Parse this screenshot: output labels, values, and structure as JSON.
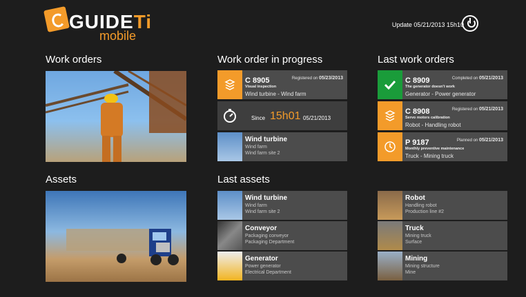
{
  "app": {
    "logo_guide": "GUIDE",
    "logo_ti": "Ti",
    "logo_mobile": "mobile",
    "update": "Update 05/21/2013 15h10"
  },
  "sections": {
    "work_orders": "Work orders",
    "in_progress": "Work order in progress",
    "last_work_orders": "Last work orders",
    "assets": "Assets",
    "last_assets": "Last assets"
  },
  "progress": {
    "code": "C 8905",
    "registered_label": "Registered on",
    "registered_date": "05/23/2013",
    "desc": "Visual inspection",
    "asset": "Wind turbine",
    "asset_sep": "-",
    "location": "Wind farm",
    "since_label": "Since",
    "since_time": "15h01",
    "since_date": "05/21/2013",
    "asset_tile": {
      "title": "Wind turbine",
      "line1": "Wind farm",
      "line2": "Wind farm site 2"
    }
  },
  "last_work_orders": [
    {
      "code": "C 8909",
      "status_label": "Completed on",
      "date": "05/21/2013",
      "desc": "The generator doesn't work",
      "asset": "Generator",
      "sep": "-",
      "location": "Power generator",
      "color": "#1a9c3a",
      "icon": "checkmark-icon"
    },
    {
      "code": "C 8908",
      "status_label": "Registered on",
      "date": "05/21/2013",
      "desc": "Servo motors calibration",
      "asset": "Robot",
      "sep": "-",
      "location": "Handling robot",
      "color": "#f39b2a",
      "icon": "stack-icon"
    },
    {
      "code": "P 9187",
      "status_label": "Planned on",
      "date": "05/21/2013",
      "desc": "Monthly preventive maintenance",
      "asset": "Truck",
      "sep": "-",
      "location": "Mining truck",
      "color": "#f39b2a",
      "icon": "clock-icon"
    }
  ],
  "last_assets": [
    {
      "title": "Wind turbine",
      "line1": "Wind farm",
      "line2": "Wind farm site 2"
    },
    {
      "title": "Conveyor",
      "line1": "Packaging conveyor",
      "line2": "Packaging Department"
    },
    {
      "title": "Generator",
      "line1": "Power generator",
      "line2": "Electrical Department"
    },
    {
      "title": "Robot",
      "line1": "Handling robot",
      "line2": "Production line #2"
    },
    {
      "title": "Truck",
      "line1": "Mining truck",
      "line2": "Surface"
    },
    {
      "title": "Mining",
      "line1": "Mining structure",
      "line2": "Mine"
    }
  ],
  "colors": {
    "accent": "#f39b2a",
    "success": "#1a9c3a",
    "tile": "#4c4c4c",
    "background": "#1d1d1d"
  }
}
